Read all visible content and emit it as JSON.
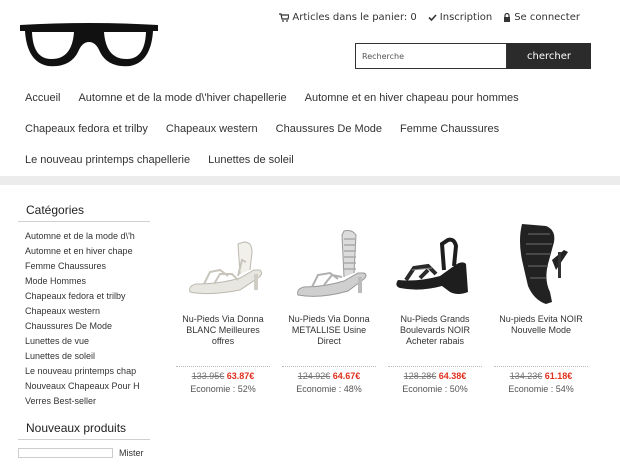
{
  "header": {
    "logo_alt": "glasses logo",
    "cart_label": "Articles dans le panier: 0",
    "register_label": "Inscription",
    "login_label": "Se connecter"
  },
  "search": {
    "placeholder": "Recherche",
    "button_label": "chercher"
  },
  "nav": {
    "row1": [
      "Accueil",
      "Automne et de la mode d\\'hiver chapellerie",
      "Automne et en hiver chapeau pour hommes"
    ],
    "row2": [
      "Chapeaux fedora et trilby",
      "Chapeaux western",
      "Chaussures De Mode",
      "Femme Chaussures"
    ],
    "row3": [
      "Le nouveau printemps chapellerie",
      "Lunettes de soleil"
    ]
  },
  "sidebar": {
    "categories_title": "Catégories",
    "categories": [
      "Automne et de la mode d\\'h",
      "Automne et en hiver chape",
      "Femme Chaussures",
      "Mode Hommes",
      "Chapeaux fedora et trilby",
      "Chapeaux western",
      "Chaussures De Mode",
      "Lunettes de vue",
      "Lunettes de soleil",
      "Le nouveau printemps chap",
      "Nouveaux Chapeaux Pour H",
      "Verres Best-seller"
    ],
    "new_products_title": "Nouveaux produits",
    "new_product_label": "Mister"
  },
  "products": [
    {
      "name": "Nu-Pieds Via Donna BLANC Meilleures offres",
      "old_price": "133.95€",
      "new_price": "63.87€",
      "economy": "Economie : 52%",
      "icon": "white-sandal",
      "color": "#e8e6e0"
    },
    {
      "name": "Nu-Pieds Via Donna METALLISE Usine Direct",
      "old_price": "124.92€",
      "new_price": "64.67€",
      "economy": "Economie : 48%",
      "icon": "silver-sandal",
      "color": "#c9c9c9"
    },
    {
      "name": "Nu-Pieds Grands Boulevards NOIR Acheter rabais",
      "old_price": "128.28€",
      "new_price": "64.38€",
      "economy": "Economie : 50%",
      "icon": "black-wedge-sandal",
      "color": "#1e1e1e"
    },
    {
      "name": "Nu-pieds Evita NOIR Nouvelle Mode",
      "old_price": "134.23€",
      "new_price": "61.18€",
      "economy": "Economie : 54%",
      "icon": "black-heel-sandal",
      "color": "#222222"
    }
  ]
}
